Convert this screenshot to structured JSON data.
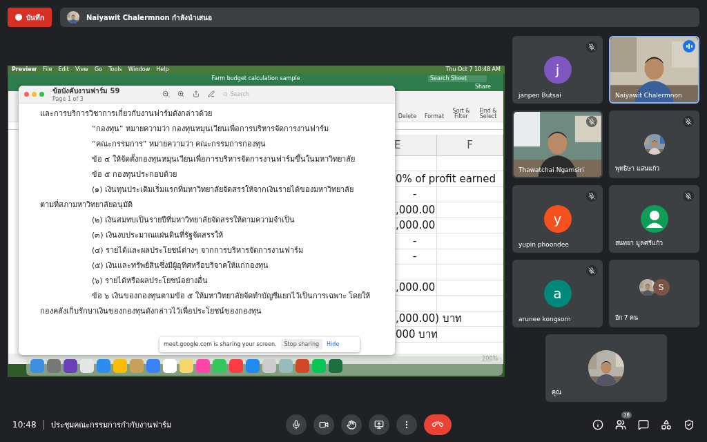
{
  "top_bar": {
    "record_button": "บันทึก",
    "presenter": "Naiyawit Chalermnon กำลังนำเสนอ"
  },
  "shared_screen": {
    "menu_bar": {
      "app": "Preview",
      "items": [
        "File",
        "Edit",
        "View",
        "Go",
        "Tools",
        "Window",
        "Help"
      ],
      "clock": "Thu Oct 7 10:48 AM"
    },
    "spreadsheet": {
      "title": "Farm budget calculation sample",
      "search_placeholder": "Search Sheet",
      "share": "Share",
      "ribbon": [
        "Delete",
        "Format",
        "Sort & Filter",
        "Find & Select"
      ],
      "columns": [
        "E",
        "F"
      ],
      "zoom": "200%",
      "rows": [
        {
          "kind": "empty"
        },
        {
          "kind": "left",
          "text": "0% of profit earned"
        },
        {
          "kind": "center",
          "text": "-"
        },
        {
          "kind": "left",
          "text": ",000.00"
        },
        {
          "kind": "left",
          "text": ",000.00"
        },
        {
          "kind": "center",
          "text": "-"
        },
        {
          "kind": "center",
          "text": "-"
        },
        {
          "kind": "empty"
        },
        {
          "kind": "left",
          "text": ",000.00"
        },
        {
          "kind": "empty"
        },
        {
          "kind": "left",
          "text": ",000.00) บาท"
        },
        {
          "kind": "left",
          "text": "000 บาท"
        }
      ]
    },
    "document": {
      "title": "ข้อบังคับงานฟาร์ม 59",
      "page": "Page 1 of 3",
      "search_placeholder": "Search",
      "lines": [
        {
          "text": "และการบริการวิชาการเกี่ยวกับงานฟาร์มดังกล่าวด้วย",
          "indent": false
        },
        {
          "text": "“กองทุน” หมายความว่า กองทุนหมุนเวียนเพื่อการบริหารจัดการงานฟาร์ม",
          "indent": true
        },
        {
          "text": "“คณะกรรมการ” หมายความว่า คณะกรรมการกองทุน",
          "indent": true
        },
        {
          "text": "ข้อ ๔ ให้จัดตั้งกองทุนหมุนเวียนเพื่อการบริหารจัดการงานฟาร์มขึ้นในมหาวิทยาลัย",
          "indent": true
        },
        {
          "text": "ข้อ ๕ กองทุนประกอบด้วย",
          "indent": true
        },
        {
          "text": "(๑) เงินทุนประเดิมเริ่มแรกที่มหาวิทยาลัยจัดสรรให้จากเงินรายได้ของมหาวิทยาลัย",
          "indent": true
        },
        {
          "text": "ตามที่สภามหาวิทยาลัยอนุมัติ",
          "indent": false
        },
        {
          "text": "(๒) เงินสมทบเป็นรายปีที่มหาวิทยาลัยจัดสรรให้ตามความจำเป็น",
          "indent": true
        },
        {
          "text": "(๓) เงินงบประมาณแผ่นดินที่รัฐจัดสรรให้",
          "indent": true
        },
        {
          "text": "(๔) รายได้และผลประโยชน์ต่างๆ จากการบริหารจัดการงานฟาร์ม",
          "indent": true
        },
        {
          "text": "(๕) เงินและทรัพย์สินซึ่งมีผู้อุทิศหรือบริจาคให้แก่กองทุน",
          "indent": true
        },
        {
          "text": "(๖) รายได้หรือผลประโยชน์อย่างอื่น",
          "indent": true
        },
        {
          "text": "ข้อ ๖ เงินของกองทุนตามข้อ ๕ ให้มหาวิทยาลัยจัดทำบัญชีแยกไว้เป็นการเฉพาะ โดยให้",
          "indent": true
        },
        {
          "text": "กองคลังเก็บรักษาเงินของกองทุนดังกล่าวไว้เพื่อประโยชน์ของกองทุน",
          "indent": false
        }
      ]
    },
    "share_notice": {
      "message": "meet.google.com is sharing your screen.",
      "stop": "Stop sharing",
      "hide": "Hide"
    }
  },
  "participants": [
    {
      "kind": "letter",
      "name": "janpen Butsai",
      "letter": "j",
      "color": "#7e57c2",
      "muted": true,
      "speaking": false
    },
    {
      "kind": "video",
      "name": "Naiyawit Chalermnon",
      "muted": false,
      "speaking": true
    },
    {
      "kind": "video",
      "name": "Thawatchai Ngamsiri",
      "muted": true,
      "speaking": false
    },
    {
      "name": "พุทธิษา แสนแก้ว",
      "muted": true,
      "speaking": false
    },
    {
      "kind": "letter",
      "name": "yupin phoondee",
      "letter": "y",
      "color": "#f4511e",
      "muted": true,
      "speaking": false
    },
    {
      "kind": "avatar",
      "name": "สนทยา มูลศรีแก้ว",
      "muted": true,
      "speaking": false
    },
    {
      "kind": "letter",
      "name": "arunee kongsorn",
      "letter": "a",
      "color": "#00897b",
      "muted": true,
      "speaking": false
    },
    {
      "kind": "others",
      "name": "อีก 7 คน",
      "letter": "S",
      "color": "#795548",
      "muted": false,
      "speaking": false
    },
    {
      "name": "คุณ",
      "muted": false,
      "speaking": false
    }
  ],
  "bottom_bar": {
    "time": "10:48",
    "meeting": "ประชุมคณะกรรมการกำกับงานฟาร์ม",
    "people_count": "16"
  }
}
